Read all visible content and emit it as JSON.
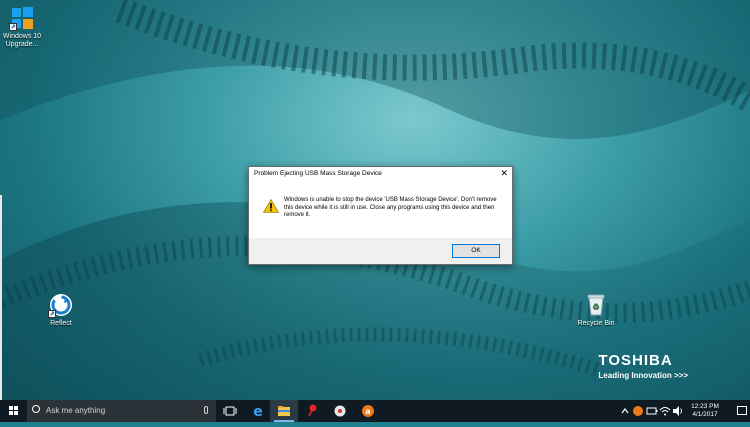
{
  "desktop": {
    "icons": [
      {
        "label": "Windows 10 Upgrade...",
        "icon": "windows-logo-icon"
      },
      {
        "label": "Reflect",
        "icon": "reflect-icon"
      },
      {
        "label": "Recycle Bin",
        "icon": "recycle-bin-icon"
      }
    ],
    "brand": {
      "name": "TOSHIBA",
      "tagline": "Leading Innovation >>>"
    }
  },
  "dialog": {
    "title": "Problem Ejecting USB Mass Storage Device",
    "message": "Windows is unable to stop the device 'USB Mass Storage Device'. Don't remove this device while it is still in use. Close any programs using this device and then remove it.",
    "ok_label": "OK",
    "icon": "warning-icon"
  },
  "taskbar": {
    "search_placeholder": "Ask me anything",
    "pinned": [
      "task-view-icon",
      "edge-icon",
      "file-explorer-icon",
      "pin-app-icon",
      "media-icon",
      "avast-icon"
    ],
    "clock": {
      "time": "12:23 PM",
      "date": "4/1/2017"
    },
    "colors": {
      "accent": "#76b9ed",
      "taskbar": "#0f1a22"
    }
  }
}
